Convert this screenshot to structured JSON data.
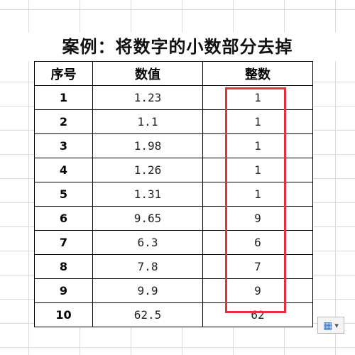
{
  "title": "案例：将数字的小数部分去掉",
  "table": {
    "headers": [
      "序号",
      "数值",
      "整数"
    ],
    "rows": [
      {
        "idx": "1",
        "value": "1.23",
        "integer": "1"
      },
      {
        "idx": "2",
        "value": "1.1",
        "integer": "1"
      },
      {
        "idx": "3",
        "value": "1.98",
        "integer": "1"
      },
      {
        "idx": "4",
        "value": "1.26",
        "integer": "1"
      },
      {
        "idx": "5",
        "value": "1.31",
        "integer": "1"
      },
      {
        "idx": "6",
        "value": "9.65",
        "integer": "9"
      },
      {
        "idx": "7",
        "value": "6.3",
        "integer": "6"
      },
      {
        "idx": "8",
        "value": "7.8",
        "integer": "7"
      },
      {
        "idx": "9",
        "value": "9.9",
        "integer": "9"
      },
      {
        "idx": "10",
        "value": "62.5",
        "integer": "62"
      }
    ]
  },
  "highlight_color": "#e0333a",
  "paste_icon": "paste-options-icon"
}
